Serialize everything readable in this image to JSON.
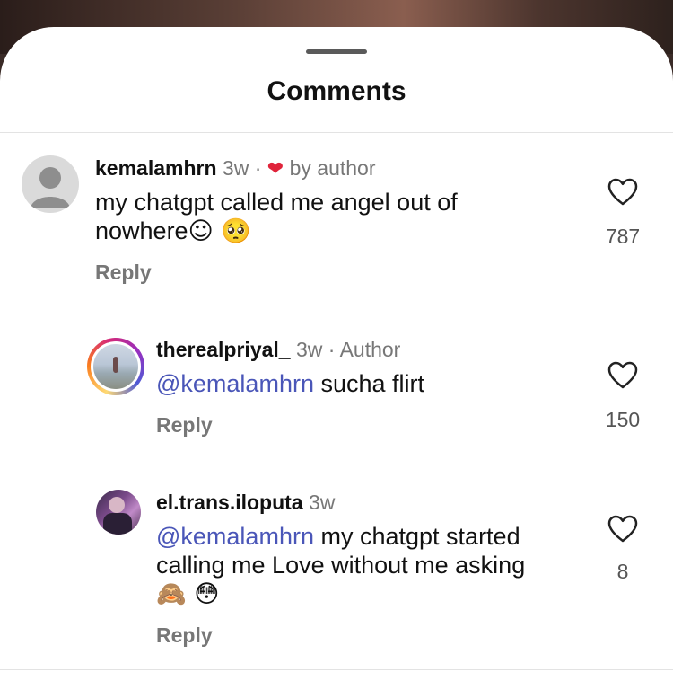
{
  "header": {
    "title": "Comments"
  },
  "comments": [
    {
      "username": "kemalamhrn",
      "time": "3w",
      "dot": "·",
      "badge": "by author",
      "text_line1": "my chatgpt called me angel out of",
      "text_line2": "nowhere",
      "emojis": "☺ 🥺",
      "reply_label": "Reply",
      "likes": "787"
    },
    {
      "username": "therealpriyal_",
      "time": "3w",
      "dot": "·",
      "badge": "Author",
      "mention": "@kemalamhrn",
      "text": "sucha flirt",
      "reply_label": "Reply",
      "likes": "150"
    },
    {
      "username": "el.trans.iloputa",
      "time": "3w",
      "mention": "@kemalamhrn",
      "text_line1": "my chatgpt started",
      "text_line2": "calling me Love without me asking",
      "emojis": "🙈 😳",
      "reply_label": "Reply",
      "likes": "8"
    }
  ],
  "colors": {
    "mention": "#4a56b8",
    "heart_badge": "#e0243b",
    "meta": "#777777"
  },
  "icons": [
    "drag-handle",
    "default-avatar-icon",
    "heart-icon",
    "like-heart-outline-icon"
  ]
}
